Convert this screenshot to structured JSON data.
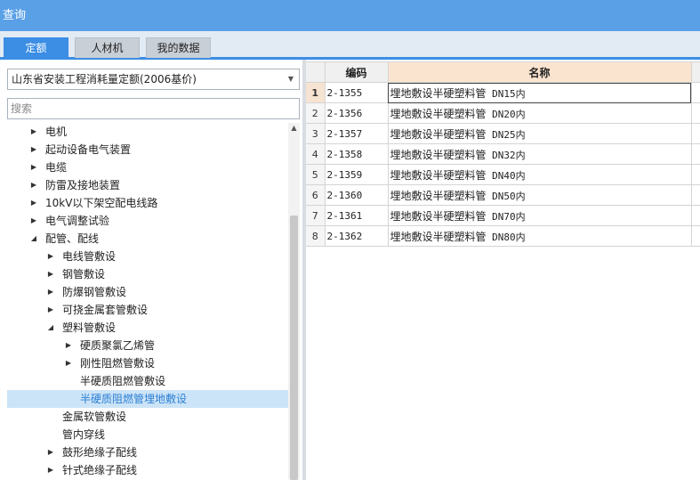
{
  "window": {
    "title": "查询"
  },
  "tabs": [
    {
      "label": "定额",
      "active": true
    },
    {
      "label": "人材机",
      "active": false
    },
    {
      "label": "我的数据",
      "active": false
    }
  ],
  "library_select": {
    "value": "山东省安装工程消耗量定额(2006基价)"
  },
  "search": {
    "placeholder": "搜索",
    "value": ""
  },
  "tree": [
    {
      "label": "电机",
      "level": 1,
      "toggle": "collapsed",
      "selected": false
    },
    {
      "label": "起动设备电气装置",
      "level": 1,
      "toggle": "collapsed",
      "selected": false
    },
    {
      "label": "电缆",
      "level": 1,
      "toggle": "collapsed",
      "selected": false
    },
    {
      "label": "防雷及接地装置",
      "level": 1,
      "toggle": "collapsed",
      "selected": false
    },
    {
      "label": "10kV以下架空配电线路",
      "level": 1,
      "toggle": "collapsed",
      "selected": false
    },
    {
      "label": "电气调整试验",
      "level": 1,
      "toggle": "collapsed",
      "selected": false
    },
    {
      "label": "配管、配线",
      "level": 1,
      "toggle": "expanded",
      "selected": false
    },
    {
      "label": "电线管敷设",
      "level": 2,
      "toggle": "collapsed",
      "selected": false
    },
    {
      "label": "钢管敷设",
      "level": 2,
      "toggle": "collapsed",
      "selected": false
    },
    {
      "label": "防爆钢管敷设",
      "level": 2,
      "toggle": "collapsed",
      "selected": false
    },
    {
      "label": "可挠金属套管敷设",
      "level": 2,
      "toggle": "collapsed",
      "selected": false
    },
    {
      "label": "塑料管敷设",
      "level": 2,
      "toggle": "expanded",
      "selected": false
    },
    {
      "label": "硬质聚氯乙烯管",
      "level": 3,
      "toggle": "collapsed",
      "selected": false
    },
    {
      "label": "刚性阻燃管敷设",
      "level": 3,
      "toggle": "collapsed",
      "selected": false
    },
    {
      "label": "半硬质阻燃管敷设",
      "level": 3,
      "toggle": "none",
      "selected": false
    },
    {
      "label": "半硬质阻燃管埋地敷设",
      "level": 3,
      "toggle": "none",
      "selected": true
    },
    {
      "label": "金属软管敷设",
      "level": 2,
      "toggle": "none",
      "selected": false
    },
    {
      "label": "管内穿线",
      "level": 2,
      "toggle": "none",
      "selected": false
    },
    {
      "label": "鼓形绝缘子配线",
      "level": 2,
      "toggle": "collapsed",
      "selected": false
    },
    {
      "label": "针式绝缘子配线",
      "level": 2,
      "toggle": "collapsed",
      "selected": false
    }
  ],
  "grid": {
    "columns": {
      "code": "编码",
      "name": "名称"
    },
    "rows": [
      {
        "no": "1",
        "code": "2-1355",
        "name": "埋地敷设半硬塑料管",
        "spec": "DN15内",
        "current": true
      },
      {
        "no": "2",
        "code": "2-1356",
        "name": "埋地敷设半硬塑料管",
        "spec": "DN20内",
        "current": false
      },
      {
        "no": "3",
        "code": "2-1357",
        "name": "埋地敷设半硬塑料管",
        "spec": "DN25内",
        "current": false
      },
      {
        "no": "4",
        "code": "2-1358",
        "name": "埋地敷设半硬塑料管",
        "spec": "DN32内",
        "current": false
      },
      {
        "no": "5",
        "code": "2-1359",
        "name": "埋地敷设半硬塑料管",
        "spec": "DN40内",
        "current": false
      },
      {
        "no": "6",
        "code": "2-1360",
        "name": "埋地敷设半硬塑料管",
        "spec": "DN50内",
        "current": false
      },
      {
        "no": "7",
        "code": "2-1361",
        "name": "埋地敷设半硬塑料管",
        "spec": "DN70内",
        "current": false
      },
      {
        "no": "8",
        "code": "2-1362",
        "name": "埋地敷设半硬塑料管",
        "spec": "DN80内",
        "current": false
      }
    ]
  },
  "colors": {
    "titlebar": "#5aa0e6",
    "active_tab": "#3b8ee4",
    "selection": "#cce4f7",
    "name_header": "#fbe4cf"
  }
}
